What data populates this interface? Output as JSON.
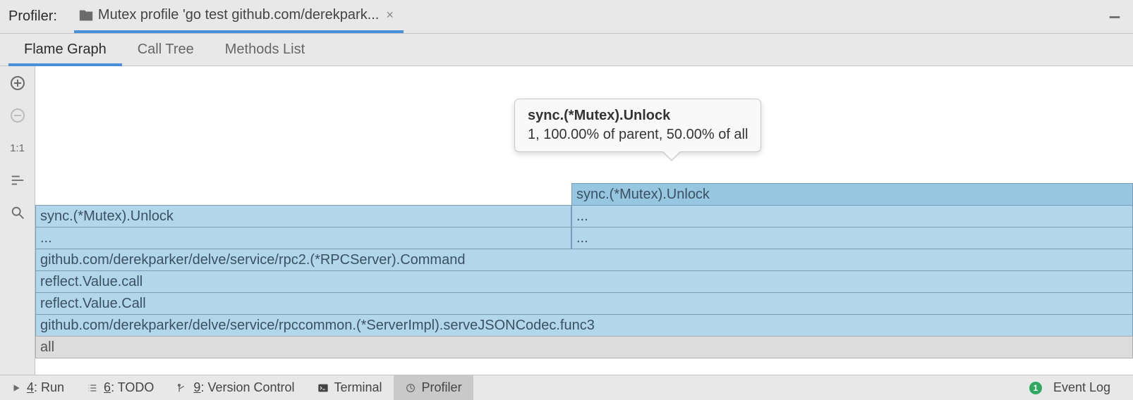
{
  "header": {
    "title": "Profiler:",
    "tab_label": "Mutex profile 'go test github.com/derekpark..."
  },
  "subtabs": {
    "flame": "Flame Graph",
    "calltree": "Call Tree",
    "methods": "Methods List"
  },
  "tooltip": {
    "title": "sync.(*Mutex).Unlock",
    "detail": "1, 100.00% of parent, 50.00% of all"
  },
  "flame": {
    "r6": "sync.(*Mutex).Unlock",
    "r5a": "sync.(*Mutex).Unlock",
    "r5b": "...",
    "r4a": "...",
    "r4b": "...",
    "r3": "github.com/derekparker/delve/service/rpc2.(*RPCServer).Command",
    "r2": "reflect.Value.call",
    "r1": "reflect.Value.Call",
    "r0": "github.com/derekparker/delve/service/rpccommon.(*ServerImpl).serveJSONCodec.func3",
    "base": "all"
  },
  "status": {
    "run_num": "4",
    "run_label": ": Run",
    "todo_num": "6",
    "todo_label": ": TODO",
    "vc_num": "9",
    "vc_label": ": Version Control",
    "terminal": "Terminal",
    "profiler": "Profiler",
    "eventlog_count": "1",
    "eventlog": "Event Log"
  }
}
